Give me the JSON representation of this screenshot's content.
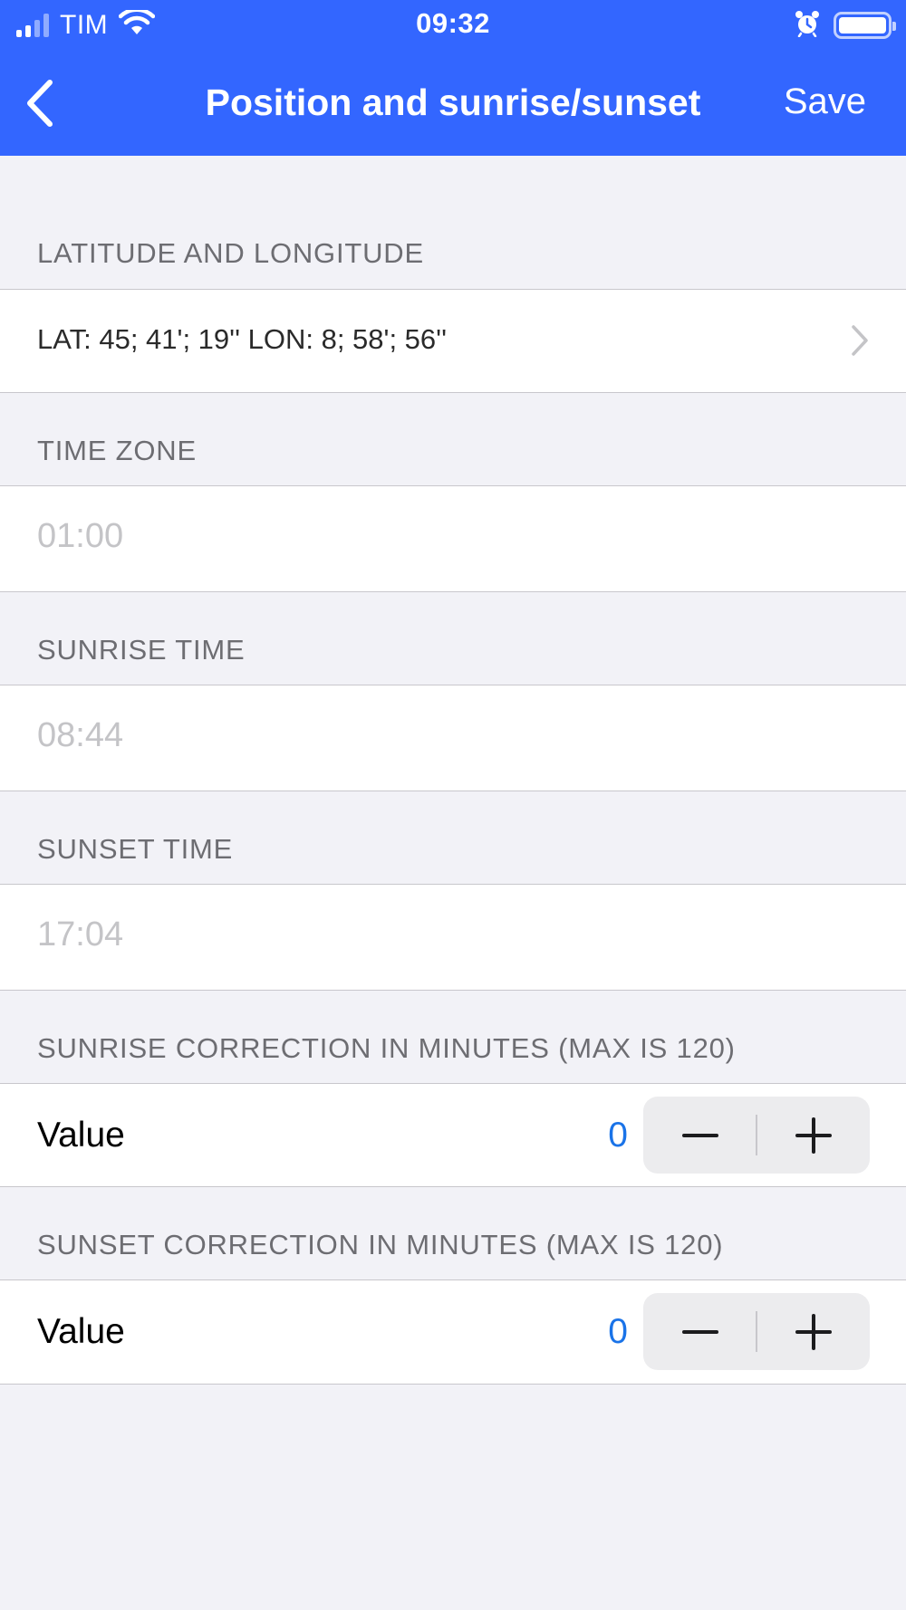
{
  "status_bar": {
    "carrier": "TIM",
    "time": "09:32"
  },
  "nav": {
    "title": "Position and sunrise/sunset",
    "save_label": "Save"
  },
  "sections": {
    "lat_lon": {
      "header": "LATITUDE AND LONGITUDE",
      "value": "LAT: 45; 41'; 19'' LON: 8; 58'; 56''"
    },
    "time_zone": {
      "header": "TIME ZONE",
      "placeholder": "01:00"
    },
    "sunrise_time": {
      "header": "SUNRISE TIME",
      "placeholder": "08:44"
    },
    "sunset_time": {
      "header": "SUNSET TIME",
      "placeholder": "17:04"
    },
    "sunrise_correction": {
      "header": "SUNRISE CORRECTION IN MINUTES (MAX IS 120)",
      "label": "Value",
      "value": "0"
    },
    "sunset_correction": {
      "header": "SUNSET CORRECTION IN MINUTES (MAX IS 120)",
      "label": "Value",
      "value": "0"
    }
  },
  "colors": {
    "header_bg": "#3366ff",
    "accent_value": "#1a73e8",
    "page_bg": "#f2f2f7"
  },
  "icons": [
    "signal-icon",
    "wifi-icon",
    "alarm-icon",
    "battery-icon",
    "back-chevron-icon",
    "disclosure-chevron-icon",
    "minus-icon",
    "plus-icon"
  ]
}
